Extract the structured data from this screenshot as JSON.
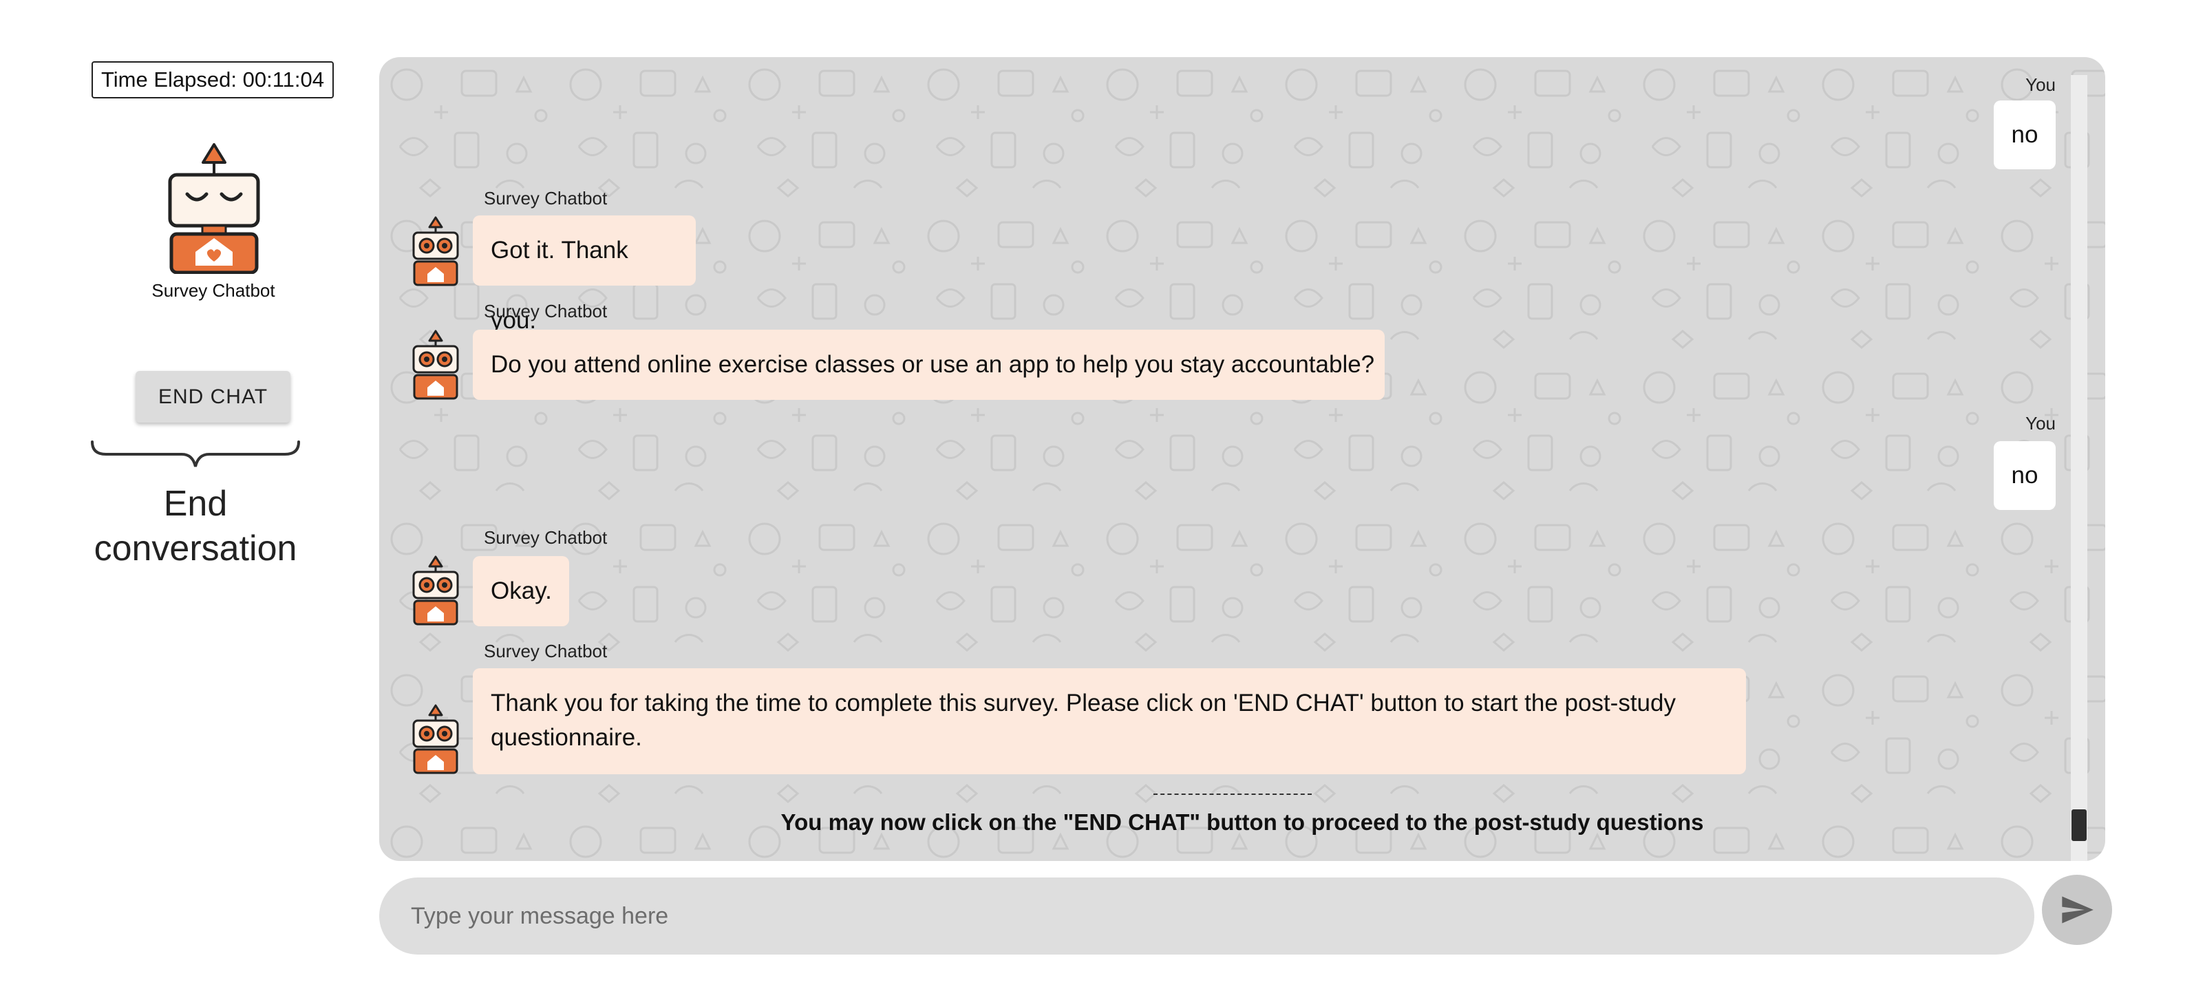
{
  "timer": {
    "label": "Time Elapsed: 00:11:04"
  },
  "left_panel": {
    "bot_name": "Survey Chatbot",
    "end_chat_label": "END CHAT",
    "end_caption_line1": "End",
    "end_caption_line2": "conversation"
  },
  "chat": {
    "messages": [
      {
        "sender": "user",
        "sender_label": "You",
        "text": "no"
      },
      {
        "sender": "bot",
        "sender_label": "Survey Chatbot",
        "text": "Got it. Thank you."
      },
      {
        "sender": "bot",
        "sender_label": "Survey Chatbot",
        "text": "Do you attend online exercise classes or use an app to help you stay accountable?"
      },
      {
        "sender": "user",
        "sender_label": "You",
        "text": "no"
      },
      {
        "sender": "bot",
        "sender_label": "Survey Chatbot",
        "text": "Okay."
      },
      {
        "sender": "bot",
        "sender_label": "Survey Chatbot",
        "text": "Thank you for taking the time to complete this survey. Please click on 'END CHAT' button to start the post-study questionnaire."
      }
    ],
    "divider": "--------------------------",
    "proceed_notice": "You may now click on the \"END CHAT\" button to proceed to the post-study questions"
  },
  "composer": {
    "placeholder": "Type your message here",
    "value": "",
    "send_icon": "send-icon"
  },
  "colors": {
    "bot_bubble": "#fde9dd",
    "user_bubble": "#ffffff",
    "chat_background": "#d9d9d9",
    "bot_orange": "#e8743b"
  }
}
